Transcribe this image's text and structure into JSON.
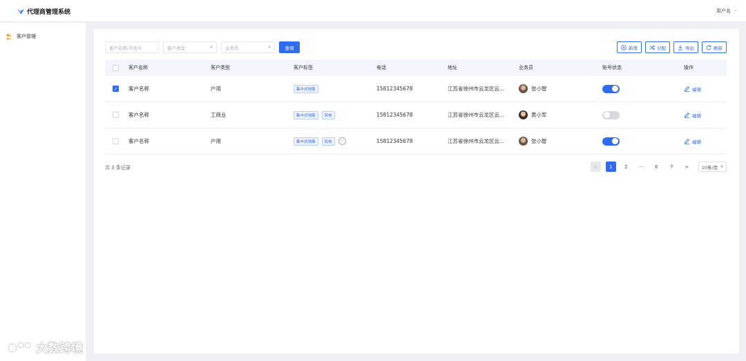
{
  "app": {
    "title": "代理商管理系统",
    "user": "用户名"
  },
  "sidebar": {
    "items": [
      {
        "label": "客户管理"
      }
    ]
  },
  "filters": {
    "customer_placeholder": "客户名称/手机号",
    "type_placeholder": "客户类型",
    "sales_placeholder": "业务员",
    "query_label": "查询"
  },
  "actions": {
    "add": "新增",
    "assign": "分配",
    "export": "导出",
    "refresh": "刷新"
  },
  "table": {
    "headers": [
      "客户名称",
      "客户类型",
      "客户标签",
      "电话",
      "地址",
      "业务员",
      "账号状态",
      "操作"
    ],
    "rows": [
      {
        "checked": true,
        "name": "客户名称",
        "type": "户用",
        "tags": [
          "集中式地面"
        ],
        "more": false,
        "phone": "15812345678",
        "address": "江苏省徐州市云龙区云...",
        "sales": "张小智",
        "active": true,
        "op": "编辑"
      },
      {
        "checked": false,
        "name": "客户名称",
        "type": "工商业",
        "tags": [
          "集中式地面",
          "风电"
        ],
        "more": false,
        "phone": "15812345678",
        "address": "江苏省徐州市云龙区云...",
        "sales": "黄小军",
        "active": false,
        "op": "编辑"
      },
      {
        "checked": false,
        "name": "客户名称",
        "type": "户用",
        "tags": [
          "集中式地面",
          "风电"
        ],
        "more": true,
        "phone": "15812345678",
        "address": "江苏省徐州市云龙区云...",
        "sales": "张小智",
        "active": true,
        "op": "编辑"
      }
    ]
  },
  "pagination": {
    "total": "共 3 条记录",
    "pages": [
      "1",
      "2",
      "···",
      "6",
      "7"
    ],
    "current": "1",
    "prev": "<",
    "next": ">",
    "size": "10条/页"
  },
  "watermark": {
    "text": "大数跨境"
  },
  "icons": {
    "more": "ellipsis-icon",
    "edit": "edit-pen-icon"
  },
  "colors": {
    "accent": "#2f6bef",
    "tag_bg": "#eef3fe",
    "header_bg": "#f2f6fc"
  }
}
